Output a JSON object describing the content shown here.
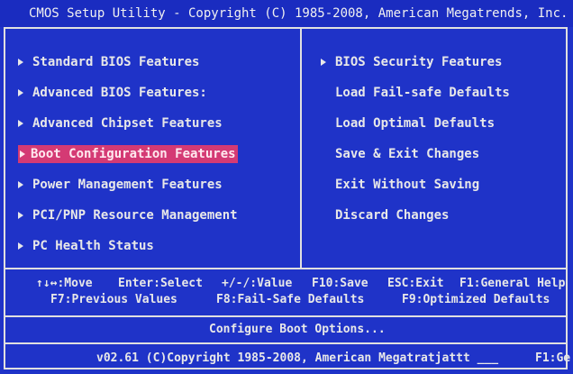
{
  "title": "CMOS Setup Utility - Copyright (C) 1985-2008, American Megatrends, Inc.",
  "menu_left": [
    {
      "label": "Standard BIOS Features",
      "selected": false
    },
    {
      "label": "Advanced BIOS Features:",
      "selected": false
    },
    {
      "label": "Advanced Chipset Features",
      "selected": false
    },
    {
      "label": "Boot Configuration Features",
      "selected": true
    },
    {
      "label": "Power Management Features",
      "selected": false
    },
    {
      "label": "PCI/PNP Resource Management",
      "selected": false
    },
    {
      "label": "PC Health Status",
      "selected": false
    }
  ],
  "menu_right": [
    {
      "label": "BIOS Security Features",
      "arrow": true
    },
    {
      "label": "Load Fail-safe Defaults",
      "arrow": false
    },
    {
      "label": "Load Optimal Defaults",
      "arrow": false
    },
    {
      "label": "Save & Exit Changes",
      "arrow": false
    },
    {
      "label": "Exit Without Saving",
      "arrow": false
    },
    {
      "label": "Discard Changes",
      "arrow": false
    }
  ],
  "help": {
    "move": "↑↓↔:Move",
    "select": "Enter:Select",
    "value": "+/-/:Value",
    "save": "F10:Save",
    "exit": "ESC:Exit",
    "general_help": "F1:General Help",
    "previous": "F7:Previous Values",
    "failsafe": "F8:Fail-Safe Defaults",
    "optimized": "F9:Optimized Defaults"
  },
  "description": "Configure Boot Options...",
  "footer": {
    "version": "v02.61 (C)Copyright 1985-2008, American Megatratjattt ___",
    "right": "F1:Ge"
  },
  "colors": {
    "background": "#1f33c8",
    "highlight": "#d43a74",
    "text": "#e8e8e8"
  }
}
